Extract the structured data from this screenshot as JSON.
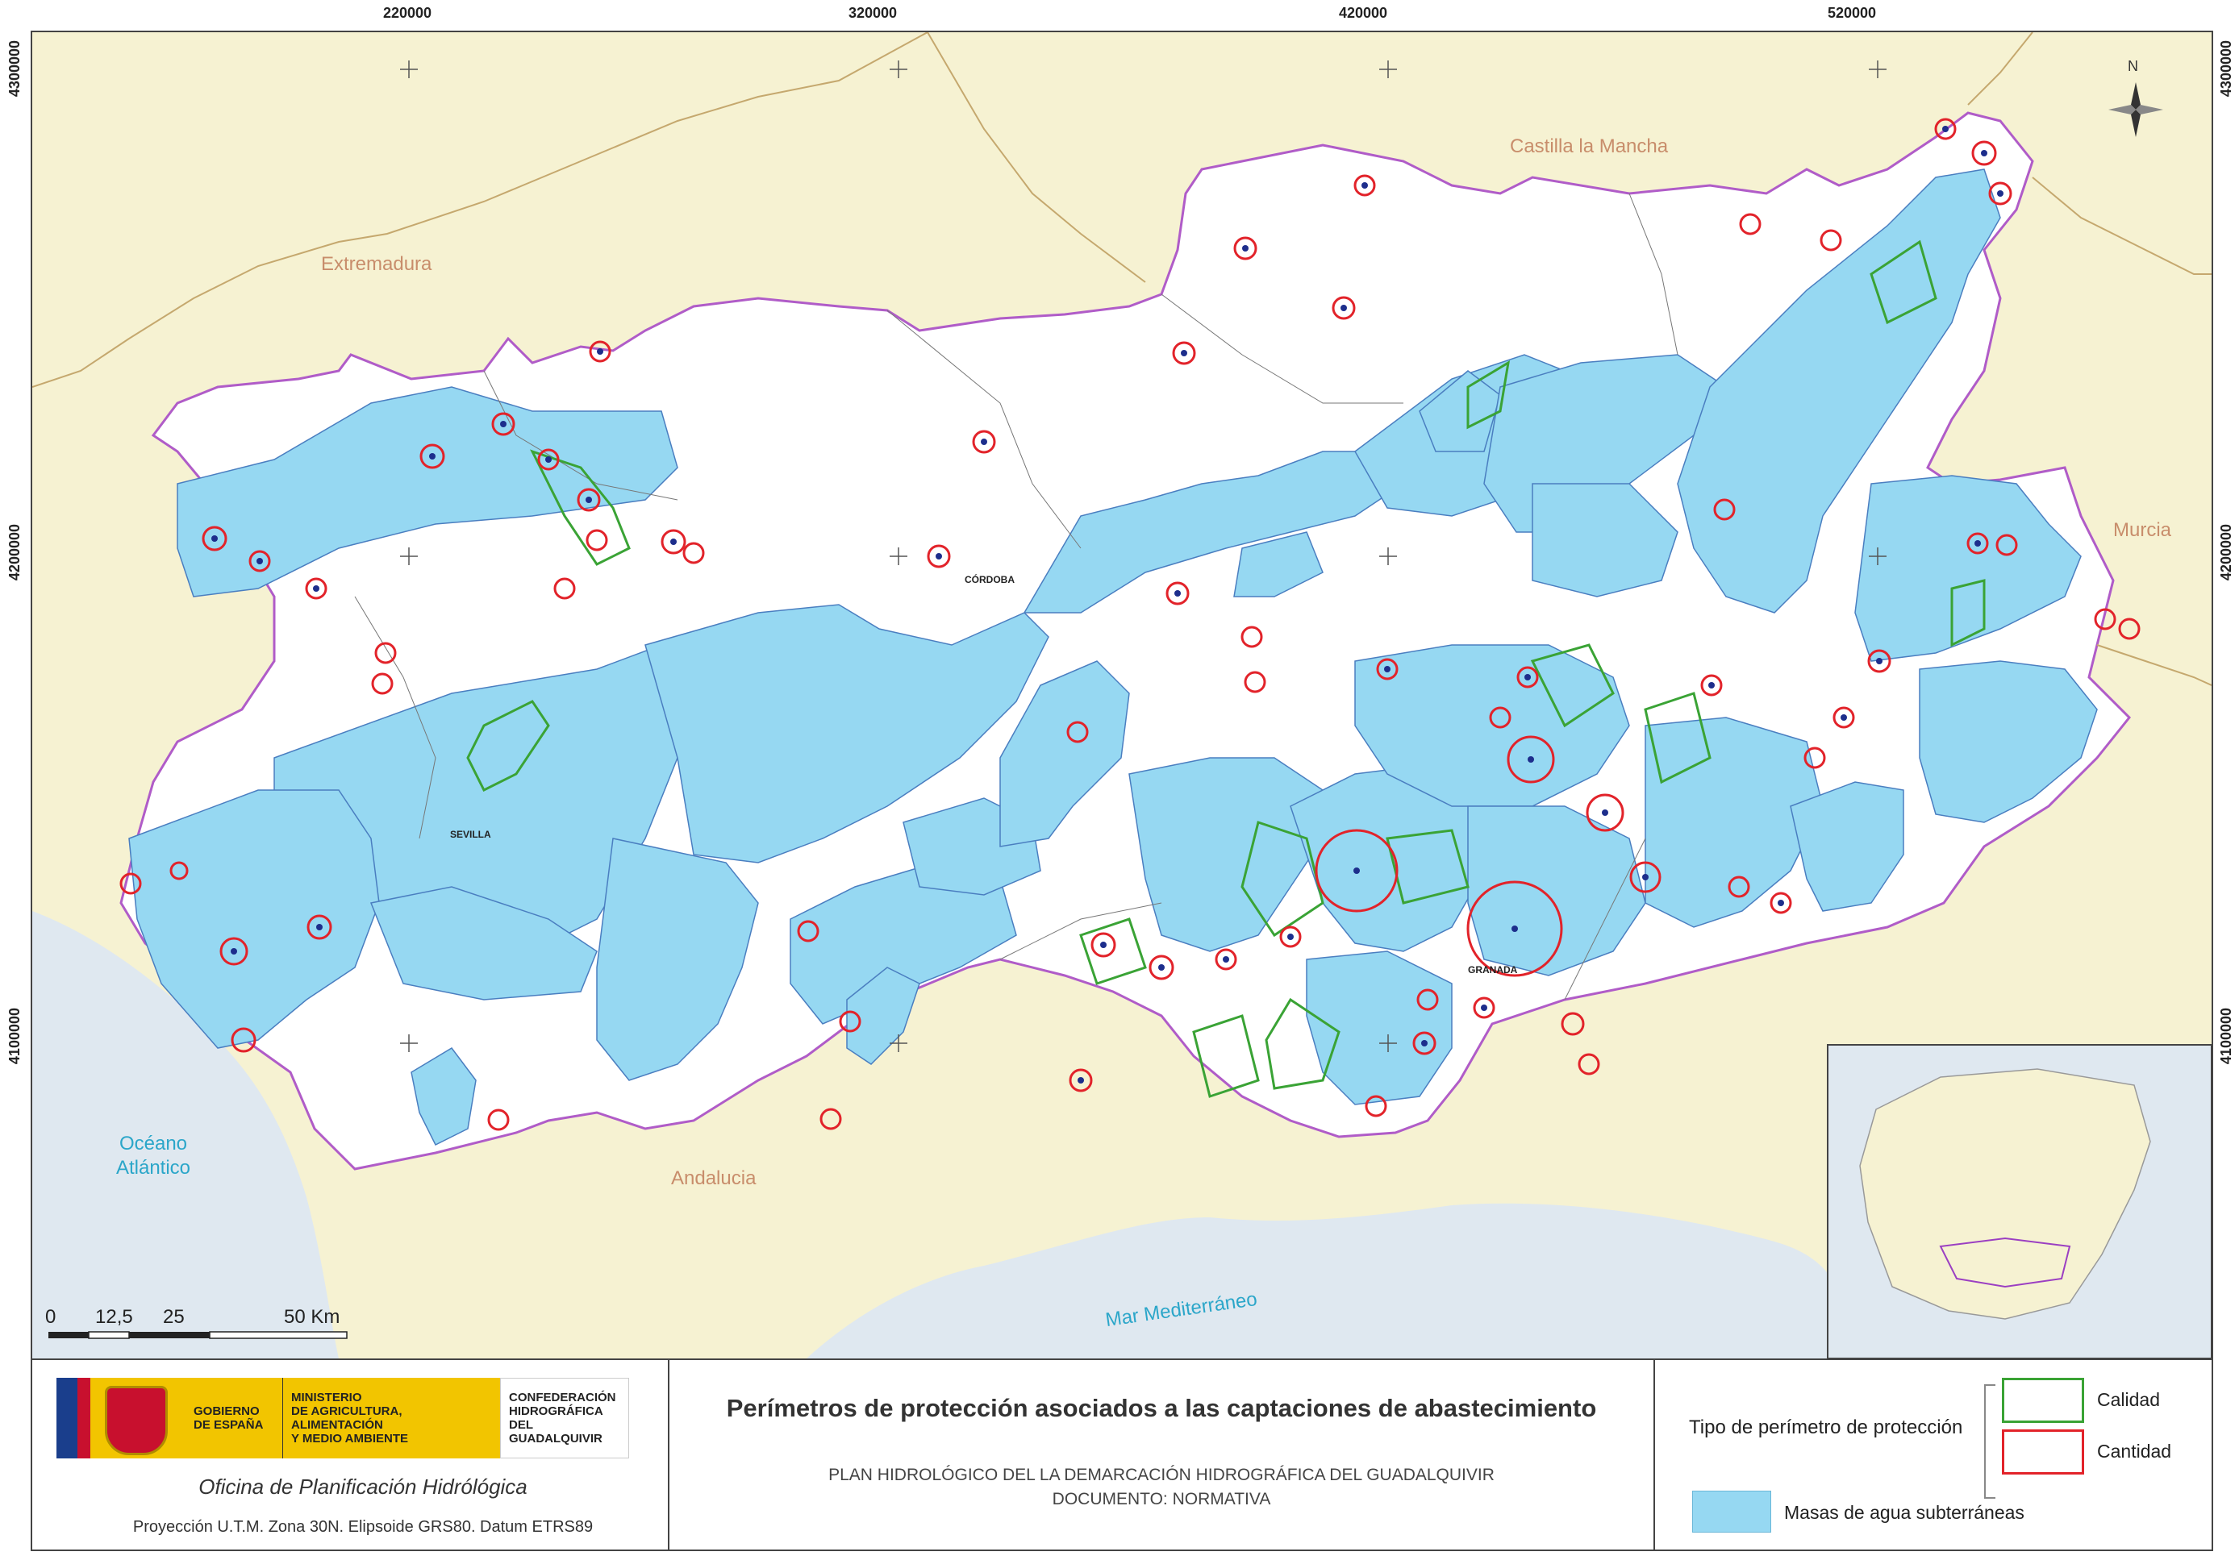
{
  "axes": {
    "x_ticks": [
      "220000",
      "320000",
      "420000",
      "520000"
    ],
    "y_ticks": [
      "4300000",
      "4200000",
      "4100000"
    ]
  },
  "regions": {
    "extremadura": "Extremadura",
    "castilla": "Castilla la Mancha",
    "murcia": "Murcia",
    "andalucia": "Andalucia"
  },
  "seas": {
    "atlantic_line1": "Océano",
    "atlantic_line2": "Atlántico",
    "mediterranean": "Mar Mediterráneo"
  },
  "cities": {
    "cordoba": "CÓRDOBA",
    "sevilla": "SEVILLA",
    "granada": "GRANADA"
  },
  "north": "N",
  "scale": {
    "labels": [
      "0",
      "12,5",
      "25",
      "50 Km"
    ]
  },
  "footer": {
    "gov_line1": "GOBIERNO",
    "gov_line2": "DE ESPAÑA",
    "ministry_line1": "MINISTERIO",
    "ministry_line2": "DE AGRICULTURA, ALIMENTACIÓN",
    "ministry_line3": "Y MEDIO AMBIENTE",
    "conf_line1": "CONFEDERACIÓN",
    "conf_line2": "HIDROGRÁFICA",
    "conf_line3": "DEL GUADALQUIVIR",
    "office": "Oficina de Planificación Hidrólógica",
    "projection": "Proyección U.T.M. Zona 30N. Elipsoide GRS80. Datum ETRS89",
    "title": "Perímetros de protección asociados a las captaciones de abastecimiento",
    "subtitle_line1": "PLAN HIDROLÓGICO DEL LA DEMARCACIÓN HIDROGRÁFICA DEL GUADALQUIVIR",
    "subtitle_line2": "DOCUMENTO: NORMATIVA"
  },
  "legend": {
    "heading": "Tipo de perímetro de protección",
    "calidad": "Calidad",
    "cantidad": "Cantidad",
    "masas": "Masas de agua subterráneas",
    "calidad_color": "#3aa335",
    "cantidad_color": "#e2232a",
    "masas_color": "#96d8f2"
  }
}
